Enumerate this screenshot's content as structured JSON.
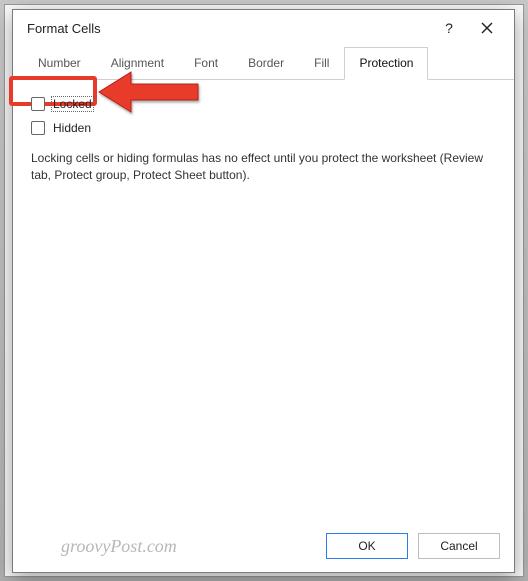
{
  "dialog": {
    "title": "Format Cells",
    "help_tooltip": "?",
    "tabs": [
      "Number",
      "Alignment",
      "Font",
      "Border",
      "Fill",
      "Protection"
    ],
    "active_tab_index": 5,
    "protection": {
      "locked_label": "Locked",
      "locked_checked": false,
      "hidden_label": "Hidden",
      "hidden_checked": false,
      "description": "Locking cells or hiding formulas has no effect until you protect the worksheet (Review tab, Protect group, Protect Sheet button)."
    },
    "buttons": {
      "ok": "OK",
      "cancel": "Cancel"
    }
  },
  "watermark": "groovyPost.com"
}
